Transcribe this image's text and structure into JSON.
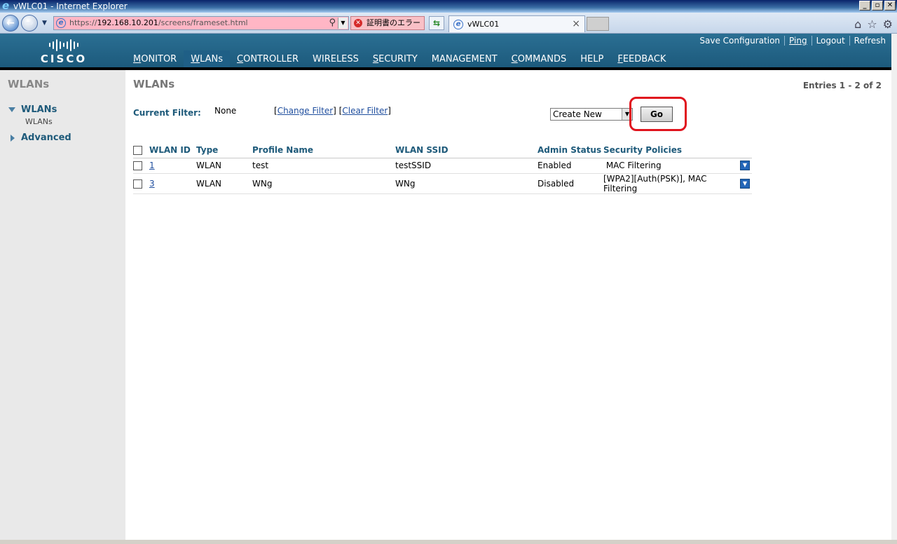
{
  "window": {
    "title": "vWLC01 - Internet Explorer",
    "controls": [
      "_",
      "▫",
      "✕"
    ]
  },
  "browser": {
    "address": {
      "prefix": "https://",
      "host": "192.168.10.201",
      "path": "/screens/frameset.html"
    },
    "cert_error": "証明書のエラー",
    "tab_label": "vWLC01"
  },
  "header": {
    "logo_text": "CISCO",
    "top_links": [
      "Save Configuration",
      "Ping",
      "Logout",
      "Refresh"
    ],
    "nav": [
      {
        "first": "M",
        "rest": "ONITOR"
      },
      {
        "first": "W",
        "rest": "LANs"
      },
      {
        "first": "C",
        "rest": "ONTROLLER"
      },
      {
        "first": "W",
        "rest": "IRELESS"
      },
      {
        "first": "S",
        "rest": "ECURITY"
      },
      {
        "first": "M",
        "rest": "ANAGEMENT"
      },
      {
        "first": "C",
        "rest": "OMMANDS"
      },
      {
        "first": "H",
        "rest": "ELP"
      },
      {
        "first": "F",
        "rest": "EEDBACK"
      }
    ],
    "active_nav": "WLANs"
  },
  "sidebar": {
    "title": "WLANs",
    "groups": [
      {
        "label": "WLANs",
        "expanded": true,
        "items": [
          "WLANs"
        ]
      },
      {
        "label": "Advanced",
        "expanded": false,
        "items": []
      }
    ]
  },
  "main": {
    "title": "WLANs",
    "entries": "Entries 1 - 2 of 2",
    "filter_label": "Current Filter:",
    "filter_value": "None",
    "change_filter": "Change Filter",
    "clear_filter": "Clear Filter",
    "action_select": "Create New",
    "go_label": "Go",
    "columns": [
      "WLAN ID",
      "Type",
      "Profile Name",
      "WLAN SSID",
      "Admin Status",
      "Security Policies"
    ],
    "rows": [
      {
        "id": "1",
        "type": "WLAN",
        "profile": "test",
        "ssid": "testSSID",
        "status": "Enabled",
        "security": " MAC Filtering"
      },
      {
        "id": "3",
        "type": "WLAN",
        "profile": "WNg",
        "ssid": "WNg",
        "status": "Disabled",
        "security": "[WPA2][Auth(PSK)], MAC Filtering"
      }
    ]
  },
  "colors": {
    "header": "#1c5a7c",
    "accent": "#f7a21b",
    "highlight_ring": "#e0141e"
  }
}
